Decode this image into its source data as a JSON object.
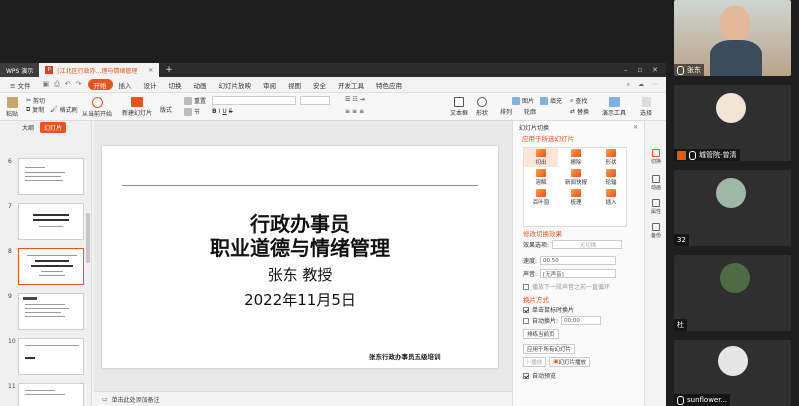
{
  "window": {
    "app_tab": "WPS 演示",
    "doc_tab": "[江北区行政办...理与情绪管理",
    "doc_badge": "P"
  },
  "menu": {
    "file": "≡ 文件",
    "items": [
      "开始",
      "插入",
      "设计",
      "切换",
      "动画",
      "幻灯片放映",
      "审阅",
      "视图",
      "安全",
      "开发工具",
      "特色应用"
    ],
    "active_index": 0
  },
  "ribbon": {
    "paste": "粘贴",
    "cut": "剪切",
    "copy": "复制",
    "format_painter": "格式刷",
    "from_current": "从当前开始",
    "new_slide": "新建幻灯片",
    "layout": "版式",
    "section": "节",
    "reset": "重置",
    "textbox": "文本框",
    "shape": "形状",
    "arrange": "排列",
    "outline": "轮廓",
    "picture": "图片",
    "fill": "填充",
    "find": "查找",
    "replace": "替换",
    "presenter_tools": "演示工具",
    "select": "选择"
  },
  "slides_panel": {
    "tab_outline": "大纲",
    "tab_slides": "幻灯片",
    "slides": [
      {
        "num": "6"
      },
      {
        "num": "7"
      },
      {
        "num": "8",
        "selected": true
      },
      {
        "num": "9"
      },
      {
        "num": "10"
      },
      {
        "num": "11"
      }
    ]
  },
  "slide": {
    "title_line1": "行政办事员",
    "title_line2": "职业道德与情绪管理",
    "presenter": "张东   教授",
    "date": "2022年11月5日",
    "footer": "张东行政办事员五级培训"
  },
  "notes_placeholder": "单击此处添加备注",
  "transition_pane": {
    "header": "幻灯片切换",
    "apply_section": "应用于所选幻灯片",
    "effects": [
      "切出",
      "擦除",
      "形状",
      "溶解",
      "新闻快报",
      "轮辐",
      "百叶窗",
      "梳理",
      "插入"
    ],
    "modify_section": "修改切换效果",
    "effect_option_label": "效果选项:",
    "effect_option_value": "无切换",
    "speed_label": "速度:",
    "speed_value": "00.50",
    "sound_label": "声音:",
    "sound_value": "[无声音]",
    "loop_sound": "播放下一段声音之前一直循环",
    "advance_section": "换片方式",
    "on_click": "单击鼠标时换片",
    "auto_advance": "自动换片:",
    "auto_value": "00:00",
    "sort_view": "排练当前页",
    "apply_all": "应用于所有幻灯片",
    "play": "播放",
    "slide_show": "幻灯片播放",
    "auto_preview": "自动预览"
  },
  "right_strip": [
    "切换",
    "动画",
    "属性",
    "备份"
  ],
  "participants": [
    {
      "name": "张东",
      "type": "video"
    },
    {
      "name": "城管院-曾清",
      "type": "avatar",
      "host": true
    },
    {
      "name": "32",
      "type": "avatar"
    },
    {
      "name": "杜",
      "type": "avatar"
    },
    {
      "name": "sunflower...",
      "type": "avatar"
    }
  ],
  "colors": {
    "accent": "#e8541e",
    "dark_bg": "#1e1e1e"
  }
}
